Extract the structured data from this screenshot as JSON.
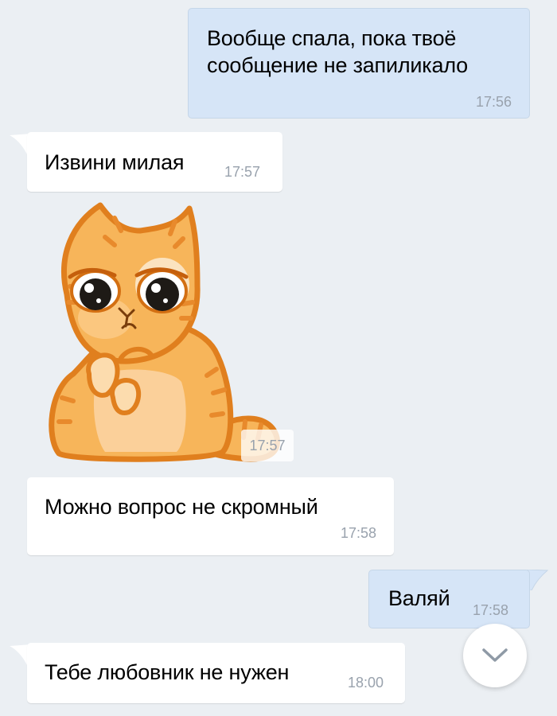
{
  "messages": [
    {
      "direction": "out",
      "text_line1": "Вообще спала, пока твоё",
      "text_line2": "сообщение не запиликало",
      "time": "17:56"
    },
    {
      "direction": "in",
      "text": "Извини милая",
      "time": "17:57"
    },
    {
      "direction": "in",
      "type": "sticker",
      "sticker": "sad-ginger-cat",
      "time": "17:57"
    },
    {
      "direction": "in",
      "text": "Можно вопрос не скромный",
      "time": "17:58"
    },
    {
      "direction": "out",
      "text": "Валяй",
      "time": "17:58"
    },
    {
      "direction": "in",
      "text": "Тебе любовник не нужен",
      "time": "18:00"
    }
  ],
  "controls": {
    "scroll_down_icon": "chevron-down-icon"
  },
  "colors": {
    "background": "#ebeff3",
    "incoming_bubble": "#ffffff",
    "outgoing_bubble": "#d6e5f7",
    "timestamp": "#99a2ad",
    "cat_fur": "#f7b55a",
    "cat_outline": "#e07f1e"
  }
}
